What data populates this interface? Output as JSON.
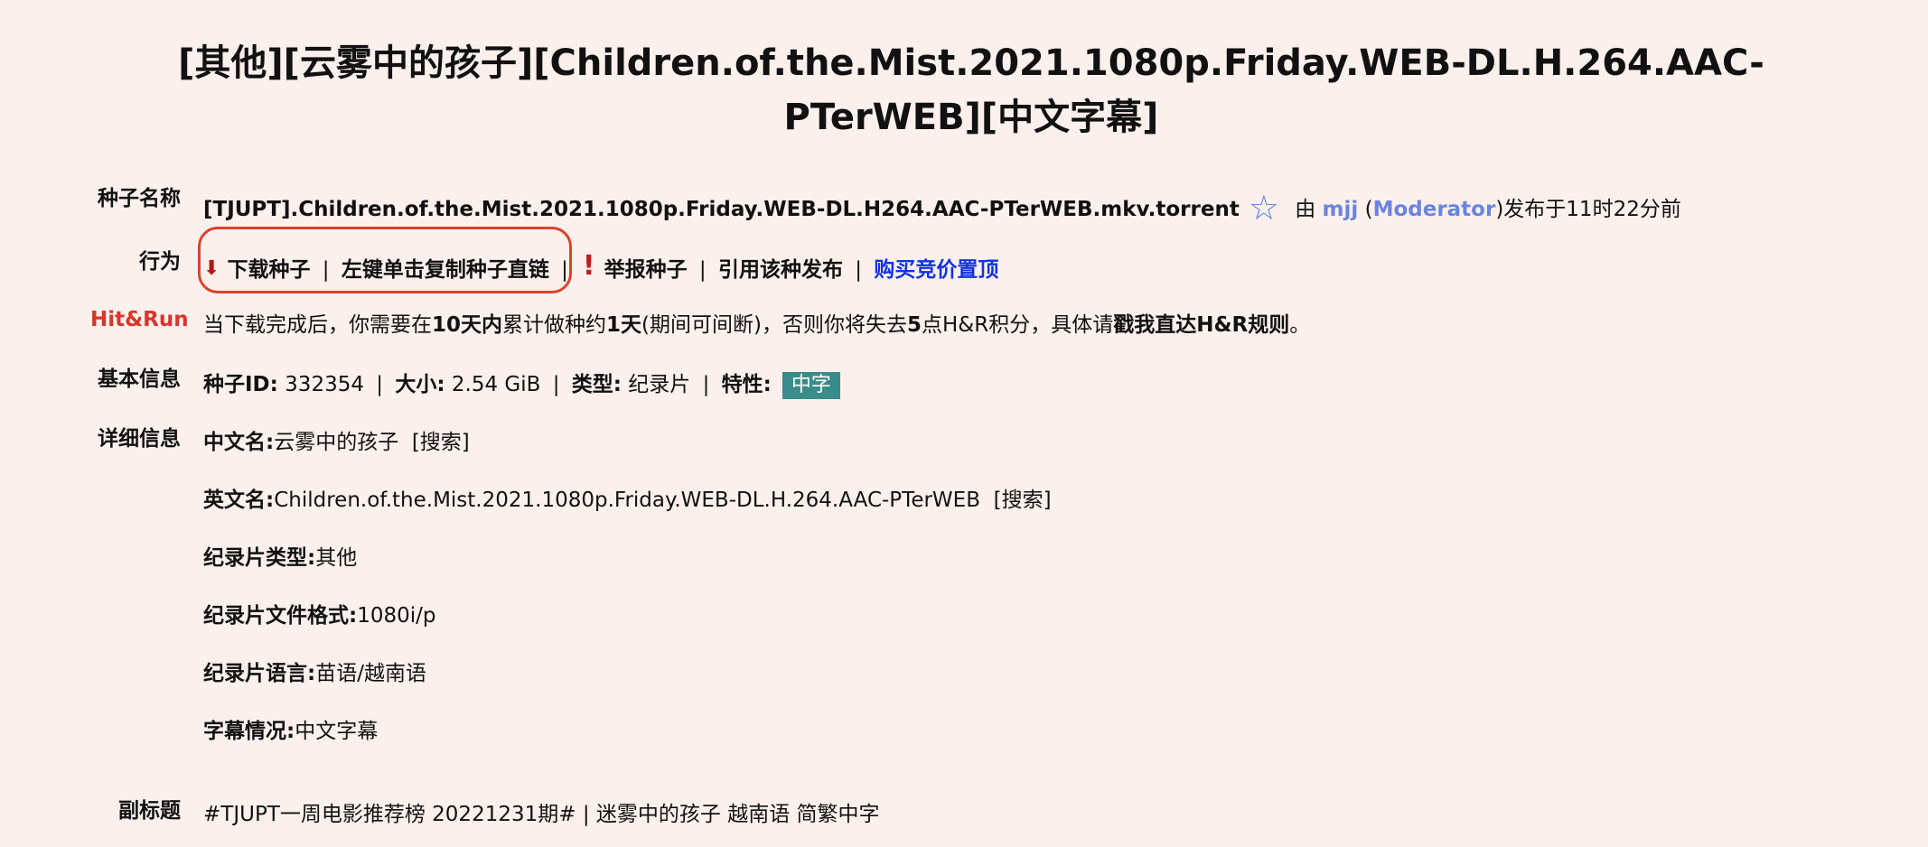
{
  "title": "[其他][云雾中的孩子][Children.of.the.Mist.2021.1080p.Friday.WEB-DL.H.264.AAC-PTerWEB][中文字幕]",
  "labels": {
    "torrent_name": "种子名称",
    "actions": "行为",
    "hitrun": "Hit&Run",
    "basic_info": "基本信息",
    "detail_info": "详细信息",
    "subtitle": "副标题"
  },
  "torrent": {
    "filename": "[TJUPT].Children.of.the.Mist.2021.1080p.Friday.WEB-DL.H264.AAC-PTerWEB.mkv.torrent",
    "star_icon": "star-outline-icon",
    "by_prefix": "由",
    "uploader": "mjj",
    "role": "Moderator",
    "posted": ")发布于11时22分前"
  },
  "actions": {
    "download": "下载种子",
    "copy_link": "左键单击复制种子直链",
    "report": "举报种子",
    "quote": "引用该种发布",
    "buy_top": "购买竞价置顶",
    "separator": "|"
  },
  "hitrun": {
    "t1": "当下载完成后，你需要在",
    "b1": "10天内",
    "t2": "累计做种约",
    "b2": "1天",
    "t3": "(期间可间断)，否则你将失去",
    "b3": "5",
    "t4": "点H&R积分，具体请",
    "b4": "戳我直达H&R规则",
    "t5": "。"
  },
  "basic": {
    "id_label": "种子ID:",
    "id_value": "332354",
    "size_label": "大小:",
    "size_value": "2.54 GiB",
    "type_label": "类型:",
    "type_value": "纪录片",
    "feature_label": "特性:",
    "badge": "中字"
  },
  "details": [
    {
      "label": "中文名:",
      "value": "云雾中的孩子",
      "search": "[搜索]"
    },
    {
      "label": "英文名:",
      "value": "Children.of.the.Mist.2021.1080p.Friday.WEB-DL.H.264.AAC-PTerWEB",
      "search": "[搜索]"
    },
    {
      "label": "纪录片类型:",
      "value": "其他"
    },
    {
      "label": "纪录片文件格式:",
      "value": "1080i/p"
    },
    {
      "label": "纪录片语言:",
      "value": "苗语/越南语"
    },
    {
      "label": "字幕情况:",
      "value": "中文字幕"
    }
  ],
  "subtitle_text": "#TJUPT一周电影推荐榜 20221231期# | 迷雾中的孩子 越南语 简繁中字"
}
